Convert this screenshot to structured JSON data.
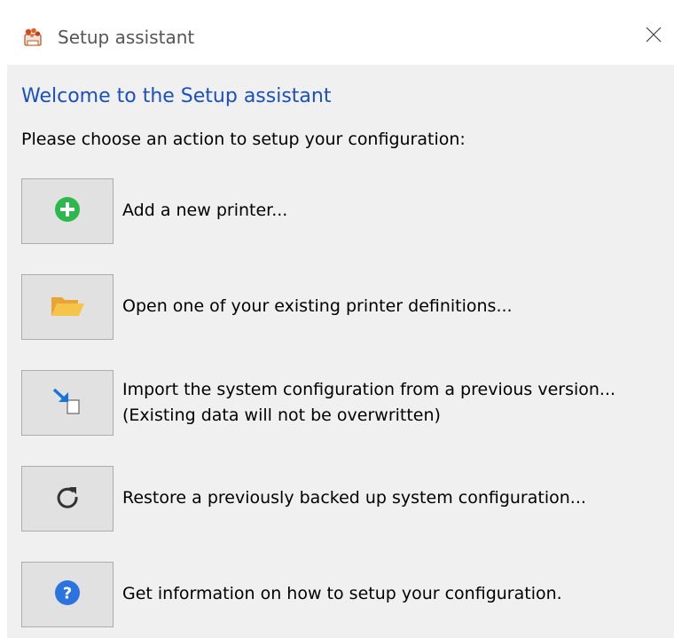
{
  "window": {
    "title": "Setup assistant",
    "close_icon": "close-icon"
  },
  "heading": "Welcome to the Setup assistant",
  "instruction": "Please choose an action to setup your configuration:",
  "actions": [
    {
      "icon": "add-icon",
      "label": "Add a new printer..."
    },
    {
      "icon": "folder-open-icon",
      "label": "Open one of your existing printer definitions..."
    },
    {
      "icon": "import-icon",
      "label": "Import the system configuration from a previous version...",
      "sublabel": "(Existing data will not be overwritten)"
    },
    {
      "icon": "restore-icon",
      "label": "Restore a previously backed up system configuration..."
    },
    {
      "icon": "help-icon",
      "label": "Get information on how to setup your configuration."
    }
  ],
  "colors": {
    "heading": "#1a4fbf",
    "window_bg": "#f0f0f0",
    "button_bg": "#e1e1e1",
    "add_green": "#2db84d",
    "help_blue": "#2b74e0",
    "folder_orange": "#f5a623"
  }
}
